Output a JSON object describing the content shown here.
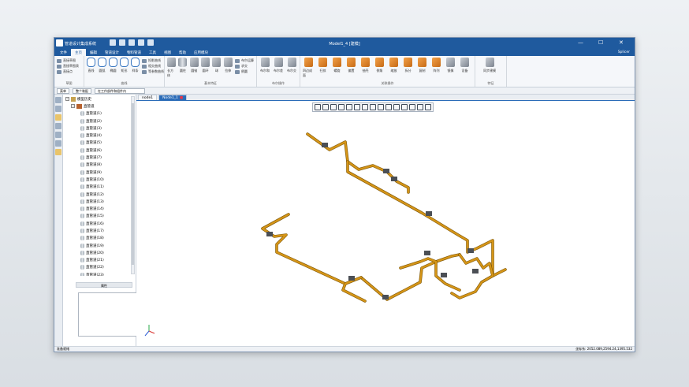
{
  "window": {
    "app_title": "管道设计集成系统",
    "doc_title": "Model1_4 [建模]",
    "controls": [
      "—",
      "☐",
      "✕"
    ]
  },
  "menu": {
    "tabs": [
      "文件",
      "主页",
      "编辑",
      "管道设计",
      "物料管道",
      "工具",
      "视图",
      "帮助",
      "应用模块"
    ],
    "active_index": 1,
    "user": "Splicer"
  },
  "ribbon": {
    "groups": [
      {
        "name": "草图",
        "items": [
          "直接草图",
          "直接草图表",
          "直接点"
        ]
      },
      {
        "name": "曲线",
        "tools": [
          "直线",
          "圆弧",
          "椭圆",
          "矩形",
          "样条"
        ],
        "items": [
          "投影曲线",
          "相交曲线",
          "等参数曲线"
        ]
      },
      {
        "name": "基本特征",
        "tools": [
          "长方体",
          "圆柱",
          "圆锥",
          "圆环",
          "球",
          "拉伸"
        ],
        "items": [
          "布尔运算",
          "求交",
          "倒圆"
        ]
      },
      {
        "name": "布尔操作",
        "tools": [
          "布尔和",
          "布尔差",
          "布尔交"
        ]
      },
      {
        "name": "关联操作",
        "tools": [
          "四边成面",
          "扫掠",
          "螺旋",
          "偏置",
          "抽壳",
          "倒角",
          "缩放",
          "拆分",
          "复制",
          "阵列",
          "镜像",
          "设备"
        ]
      },
      {
        "name": "特征",
        "tools": [
          "同步建模"
        ]
      }
    ]
  },
  "toolbar2": {
    "filter_label": "菜单",
    "filter_value": "整个装配",
    "scope_value": "在工作部件和组件内"
  },
  "tree": {
    "root": "模型历史",
    "group": "直管道",
    "item_prefix": "直管道",
    "items": [
      "直管道(1)",
      "直管道(2)",
      "直管道(3)",
      "直管道(4)",
      "直管道(5)",
      "直管道(6)",
      "直管道(7)",
      "直管道(8)",
      "直管道(9)",
      "直管道(10)",
      "直管道(11)",
      "直管道(12)",
      "直管道(13)",
      "直管道(14)",
      "直管道(15)",
      "直管道(16)",
      "直管道(17)",
      "直管道(18)",
      "直管道(19)",
      "直管道(20)",
      "直管道(21)",
      "直管道(22)",
      "直管道(23)",
      "直管道(24)",
      "直管道(25)"
    ]
  },
  "properties": {
    "header": "属性"
  },
  "doc_tabs": [
    {
      "label": "node1",
      "active": false
    },
    {
      "label": "Node1_1",
      "active": true
    }
  ],
  "status": {
    "left": "准备就绪",
    "coords": "坐标系: 2052.089,2594.24,1395.532"
  },
  "colors": {
    "title_bar": "#1f5a9e",
    "pipe": "#c98a14",
    "valve": "#555555",
    "accent": "#2b6cb8"
  }
}
